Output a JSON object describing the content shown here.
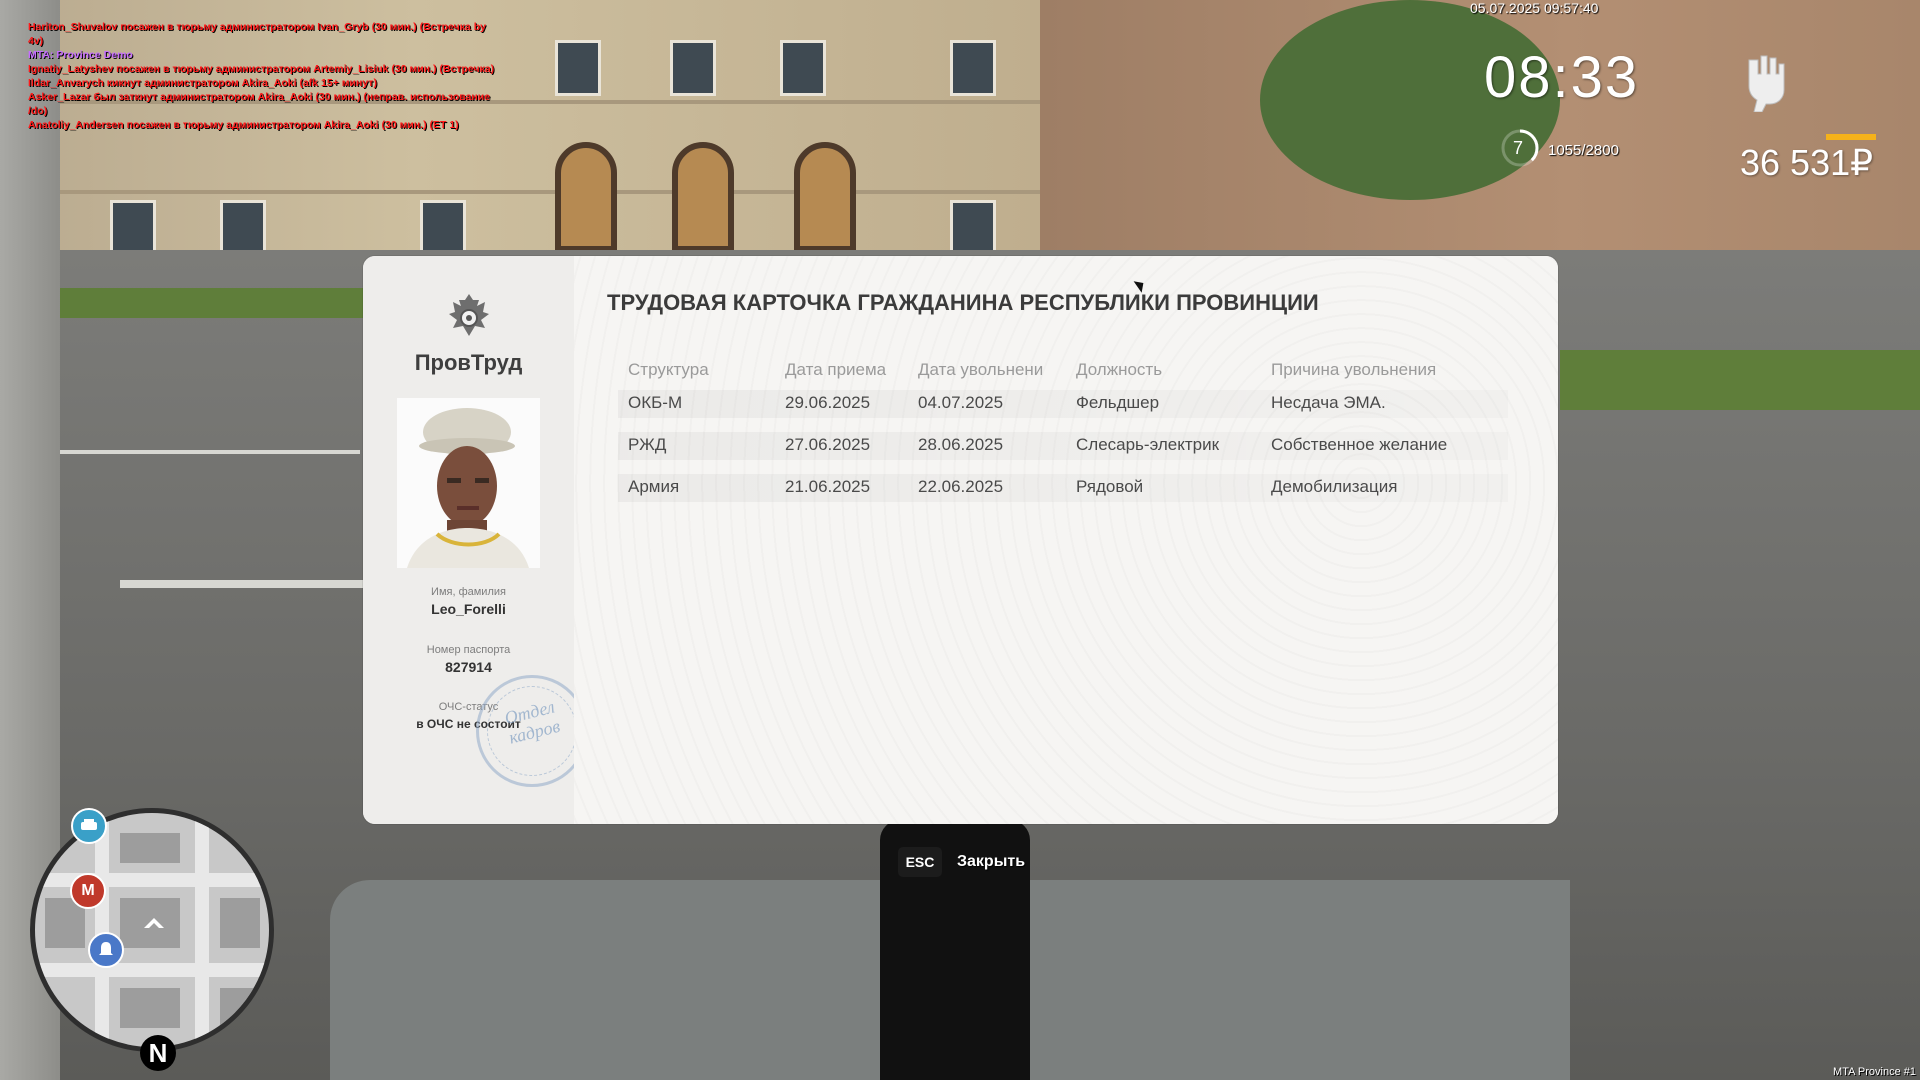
{
  "chat": [
    {
      "text": "Hariton_Shuvalov посажен в тюрьму администратором Ivan_Gryb (30 мин.) (Встречка by 4v)",
      "color": "#ff1a1a"
    },
    {
      "text": "MTA: Province Demo",
      "color": "#c66cff"
    },
    {
      "text": "Ignatiy_Latyshev посажен в тюрьму администратором Artemiy_Lisiuk (30 мин.) (Встречка)",
      "color": "#ff1a1a"
    },
    {
      "text": "Ildar_Anvarych кикнут администратором Akira_Aoki (afk 15+ минут)",
      "color": "#ff1a1a"
    },
    {
      "text": "Asker_Lazar был заткнут администратором Akira_Aoki (30 мин.) (неправ. использование /do)",
      "color": "#ff1a1a"
    },
    {
      "text": "Anatoliy_Andersen посажен в тюрьму администратором Akira_Aoki (30 мин.) (ЕТ 1)",
      "color": "#ff1a1a"
    }
  ],
  "hud": {
    "datetime": "05.07.2025 09:57:40",
    "clock": "08:33",
    "level": "7",
    "xp": "1055/2800",
    "xp_fraction": 0.377,
    "money": "36 531₽",
    "fist_icon": "fist-icon",
    "server": "MTA Province #1"
  },
  "minimap": {
    "icons": [
      "taxi-icon",
      "metro-icon",
      "bell-icon",
      "player-arrow-icon"
    ],
    "metro_label": "M",
    "north_label": "N"
  },
  "card": {
    "brand": "ПровТруд",
    "title": "ТРУДОВАЯ КАРТОЧКА ГРАЖДАНИНА РЕСПУБЛИКИ ПРОВИНЦИИ",
    "name_label": "Имя, фамилия",
    "name_value": "Leo_Forelli",
    "passport_label": "Номер паспорта",
    "passport_value": "827914",
    "ochs_label": "ОЧС-статус",
    "ochs_value": "в ОЧС не состоит",
    "stamp_text_1": "Отдел",
    "stamp_text_2": "кадров",
    "columns": [
      "Структура",
      "Дата приема",
      "Дата увольнени",
      "Должность",
      "Причина увольнения"
    ],
    "rows": [
      [
        "ОКБ-М",
        "29.06.2025",
        "04.07.2025",
        "Фельдшер",
        "Несдача ЭМА."
      ],
      [
        "РЖД",
        "27.06.2025",
        "28.06.2025",
        "Слесарь-электрик",
        "Собственное желание"
      ],
      [
        "Армия",
        "21.06.2025",
        "22.06.2025",
        "Рядовой",
        "Демобилизация"
      ]
    ]
  },
  "footer": {
    "esc_key": "ESC",
    "close_label": "Закрыть"
  }
}
